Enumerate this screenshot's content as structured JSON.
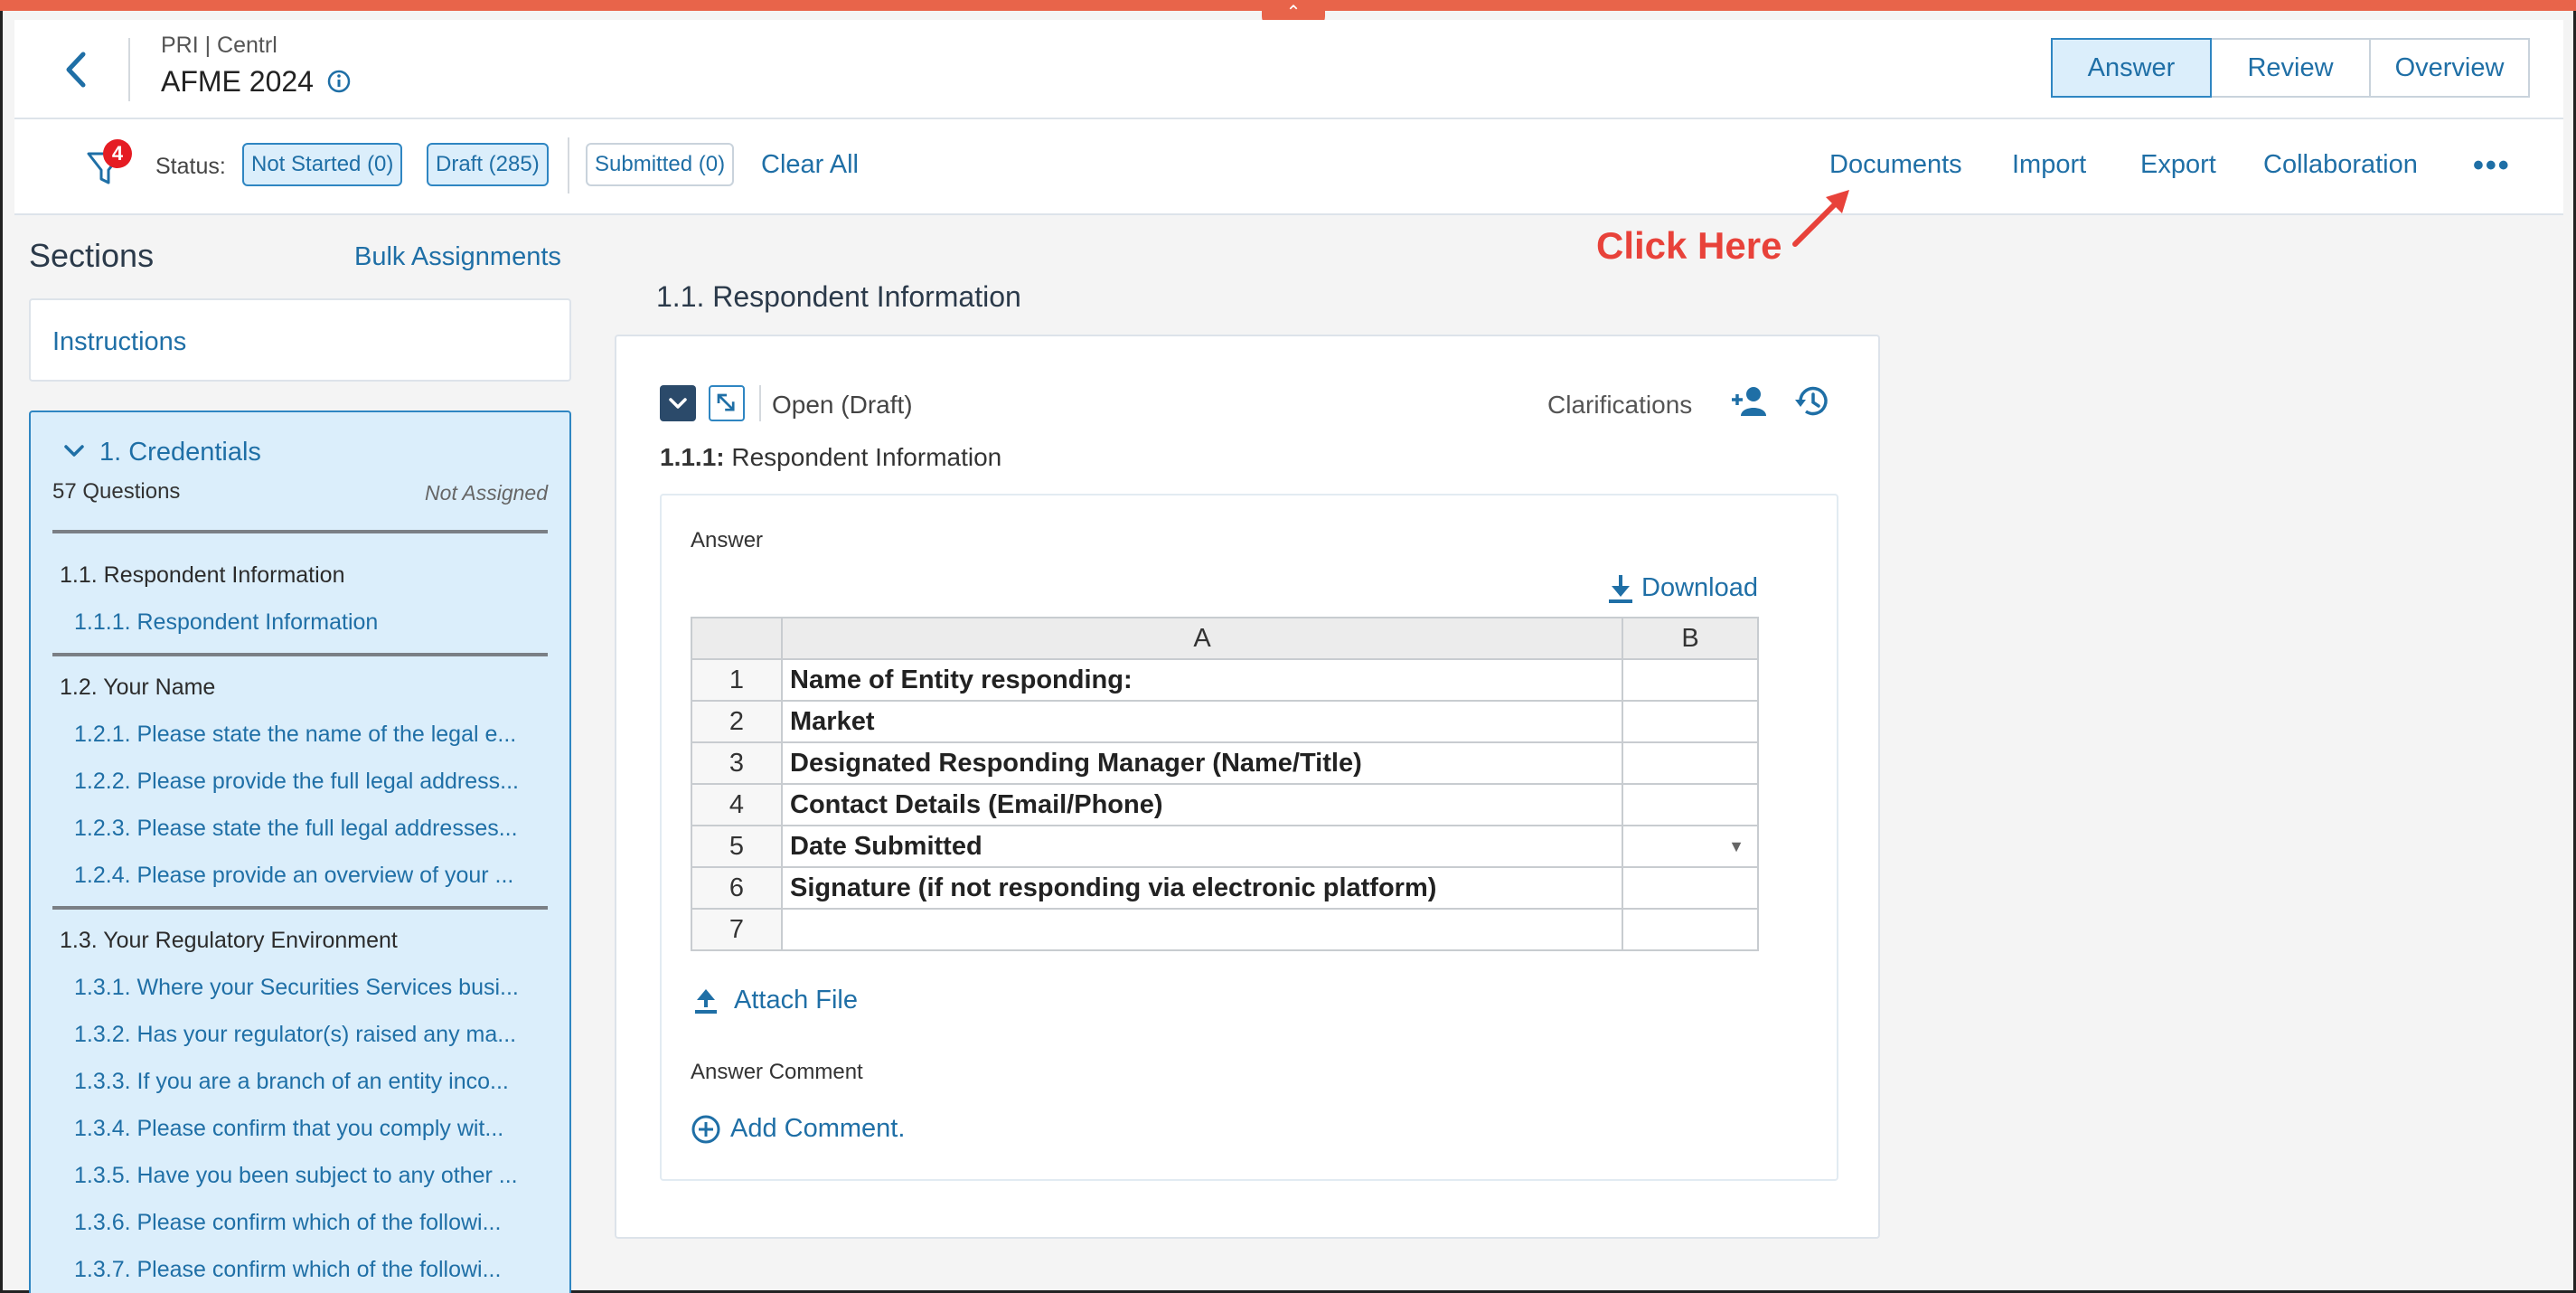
{
  "header": {
    "breadcrumb": "PRI | Centrl",
    "title": "AFME 2024",
    "tabs": [
      {
        "label": "Answer",
        "active": true
      },
      {
        "label": "Review",
        "active": false
      },
      {
        "label": "Overview",
        "active": false
      }
    ]
  },
  "toolbar": {
    "filter_badge": "4",
    "status_label": "Status:",
    "chips": [
      {
        "label": "Not Started (0)",
        "selected": true
      },
      {
        "label": "Draft (285)",
        "selected": true
      },
      {
        "label": "Submitted (0)",
        "selected": false
      }
    ],
    "clear_all": "Clear All",
    "links": [
      "Documents",
      "Import",
      "Export",
      "Collaboration"
    ],
    "more": "•••"
  },
  "annotation": {
    "text": "Click Here",
    "color": "#e8423a"
  },
  "sidebar": {
    "title": "Sections",
    "bulk_assignments": "Bulk Assignments",
    "instructions": "Instructions",
    "section": {
      "title": "1. Credentials",
      "question_count": "57 Questions",
      "assignment": "Not Assigned",
      "groups": [
        {
          "label": "1.1. Respondent Information",
          "items": [
            "1.1.1. Respondent Information"
          ]
        },
        {
          "label": "1.2. Your Name",
          "items": [
            "1.2.1. Please state the name of the legal e...",
            "1.2.2. Please provide the full legal address...",
            "1.2.3. Please state the full legal addresses...",
            "1.2.4. Please provide an overview of your ..."
          ]
        },
        {
          "label": "1.3. Your Regulatory Environment",
          "items": [
            "1.3.1. Where your Securities Services busi...",
            "1.3.2. Has your regulator(s) raised any ma...",
            "1.3.3. If you are a branch of an entity inco...",
            "1.3.4. Please confirm that you comply wit...",
            "1.3.5. Have you been subject to any other ...",
            "1.3.6. Please confirm which of the followi...",
            "1.3.7. Please confirm which of the followi..."
          ]
        }
      ]
    }
  },
  "main": {
    "heading": "1.1. Respondent Information",
    "status": "Open (Draft)",
    "clarifications": "Clarifications",
    "question_number": "1.1.1:",
    "question_title": "Respondent Information",
    "answer_label": "Answer",
    "download": "Download",
    "grid": {
      "columns": [
        "A",
        "B"
      ],
      "rows": [
        {
          "n": "1",
          "a": "Name of Entity responding:",
          "b": ""
        },
        {
          "n": "2",
          "a": "Market",
          "b": ""
        },
        {
          "n": "3",
          "a": "Designated Responding Manager (Name/Title)",
          "b": ""
        },
        {
          "n": "4",
          "a": "Contact Details (Email/Phone)",
          "b": ""
        },
        {
          "n": "5",
          "a": "Date Submitted",
          "b": "",
          "dropdown": true
        },
        {
          "n": "6",
          "a": "Signature (if not responding via electronic platform)",
          "b": ""
        },
        {
          "n": "7",
          "a": "",
          "b": ""
        }
      ]
    },
    "attach_file": "Attach File",
    "answer_comment_label": "Answer Comment",
    "add_comment": "Add Comment."
  },
  "colors": {
    "accent": "#1f6fa6",
    "top_bar": "#e8644a",
    "selected_bg": "#dbeefb",
    "badge": "#e51c23"
  }
}
